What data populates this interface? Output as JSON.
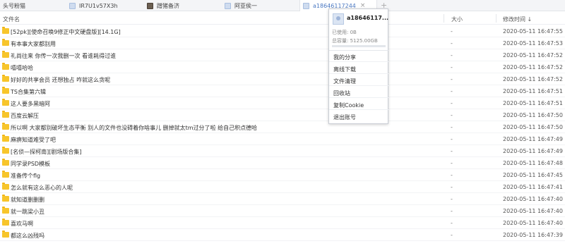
{
  "tabs": [
    {
      "label": "头号粉猫",
      "avatar": "none"
    },
    {
      "label": "IR7U1v57X3h",
      "avatar": "blue"
    },
    {
      "label": "蹭猪备济",
      "avatar": "dark"
    },
    {
      "label": "阿亚侯一",
      "avatar": "blue"
    },
    {
      "label": "a18646117244",
      "avatar": "blue",
      "active": true,
      "close": "×"
    }
  ],
  "new_tab": "+",
  "columns": {
    "name": "文件名",
    "size": "大小",
    "modified": "修改时间 ↓"
  },
  "files": [
    {
      "name": "[52pk][使命召唤9修正中文硬盘版][14.1G]",
      "size": "-",
      "time": "2020-05-11 16:47:55"
    },
    {
      "name": "有本事大家都别用",
      "size": "-",
      "time": "2020-05-11 16:47:53"
    },
    {
      "name": "礼尚往来 你传一次我删一次 看谁耗得过谁",
      "size": "-",
      "time": "2020-05-11 16:47:52"
    },
    {
      "name": "嘻嘻哈哈",
      "size": "-",
      "time": "2020-05-11 16:47:52"
    },
    {
      "name": "好好的共享会员 还想独占 咋就这么贪呢",
      "size": "-",
      "time": "2020-05-11 16:47:52"
    },
    {
      "name": "TS合集第六辑",
      "size": "-",
      "time": "2020-05-11 16:47:51"
    },
    {
      "name": "这人要多黑暗阿",
      "size": "-",
      "time": "2020-05-11 16:47:51"
    },
    {
      "name": "百度云解压",
      "size": "-",
      "time": "2020-05-11 16:47:50"
    },
    {
      "name": "所以啊 大家都别破坏生态平衡 别人的文件也没碍着你啥事儿 删掉就太tm过分了啦 给自己积点德哈",
      "size": "-",
      "time": "2020-05-11 16:47:50"
    },
    {
      "name": "麻痹知道难受了吧",
      "size": "-",
      "time": "2020-05-11 16:47:49"
    },
    {
      "name": "[名侦—探柯南][剧场版合集]",
      "size": "-",
      "time": "2020-05-11 16:47:49"
    },
    {
      "name": "同学录PSD模板",
      "size": "-",
      "time": "2020-05-11 16:47:48"
    },
    {
      "name": "准备传个flg",
      "size": "-",
      "time": "2020-05-11 16:47:45"
    },
    {
      "name": "怎么就有这么恶心的人呢",
      "size": "-",
      "time": "2020-05-11 16:47:41"
    },
    {
      "name": "就知道删删删",
      "size": "-",
      "time": "2020-05-11 16:47:40"
    },
    {
      "name": "就一跳梁小丑",
      "size": "-",
      "time": "2020-05-11 16:47:40"
    },
    {
      "name": "喜欢马啊",
      "size": "-",
      "time": "2020-05-11 16:47:40"
    },
    {
      "name": "都这么凶残吗",
      "size": "-",
      "time": "2020-05-11 16:47:39"
    }
  ],
  "account_menu": {
    "username": "a18646117...",
    "used": "已使用: 0B",
    "total": "总容量: 5125.00GB",
    "usage_fraction": 0.0,
    "items": [
      "我的分享",
      "离线下载",
      "文件清理",
      "回收站",
      "复制Cookie",
      "退出账号"
    ]
  }
}
